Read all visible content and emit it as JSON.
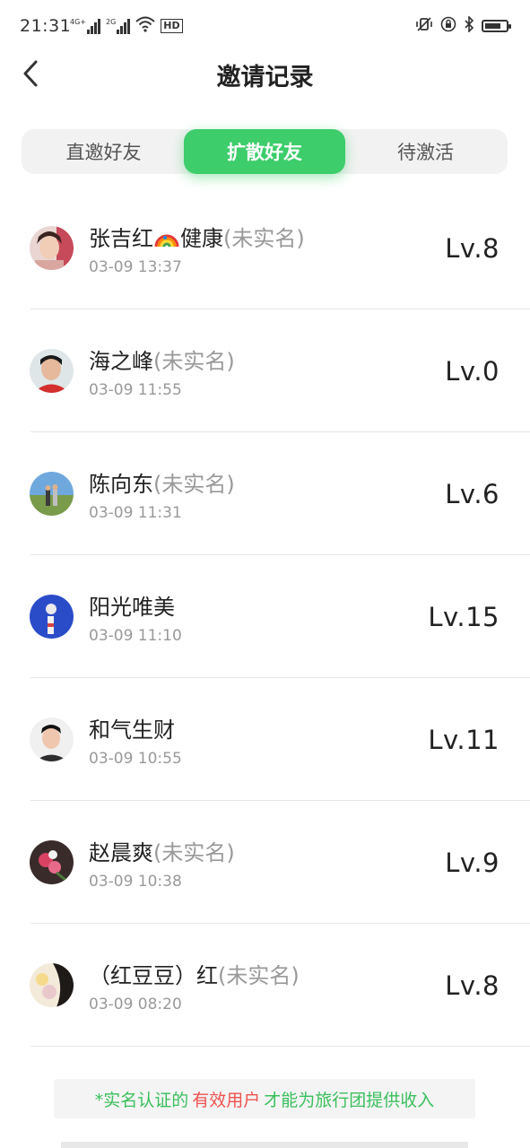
{
  "status_bar": {
    "time": "21:31",
    "signal1_label": "4G+",
    "signal2_label": "2G",
    "hd_label": "HD",
    "battery_level": 0.75
  },
  "nav": {
    "title": "邀请记录",
    "back_icon": "chevron-left-icon"
  },
  "tabs": [
    {
      "label": "直邀好友",
      "active": false
    },
    {
      "label": "扩散好友",
      "active": true
    },
    {
      "label": "待激活",
      "active": false
    }
  ],
  "records": [
    {
      "name": "张吉红",
      "name_suffix": "健康",
      "unverified": "(未实名)",
      "time": "03-09 13:37",
      "level": "Lv.8",
      "has_rainbow": true
    },
    {
      "name": "海之峰",
      "name_suffix": "",
      "unverified": "(未实名)",
      "time": "03-09 11:55",
      "level": "Lv.0",
      "has_rainbow": false
    },
    {
      "name": "陈向东",
      "name_suffix": "",
      "unverified": "(未实名)",
      "time": "03-09 11:31",
      "level": "Lv.6",
      "has_rainbow": false
    },
    {
      "name": "阳光唯美",
      "name_suffix": "",
      "unverified": "",
      "time": "03-09 11:10",
      "level": "Lv.15",
      "has_rainbow": false
    },
    {
      "name": "和气生财",
      "name_suffix": "",
      "unverified": "",
      "time": "03-09 10:55",
      "level": "Lv.11",
      "has_rainbow": false
    },
    {
      "name": "赵晨爽",
      "name_suffix": "",
      "unverified": "(未实名)",
      "time": "03-09 10:38",
      "level": "Lv.9",
      "has_rainbow": false
    },
    {
      "name": "（红豆豆）红",
      "name_suffix": "",
      "unverified": "(未实名)",
      "time": "03-09 08:20",
      "level": "Lv.8",
      "has_rainbow": false
    }
  ],
  "notice": {
    "part1": "*实名认证的",
    "part2": "有效用户",
    "part3": "才能为旅行团提供收入"
  },
  "colors": {
    "accent": "#3dcd6b",
    "notice_green": "#3bbf5c",
    "notice_red": "#ef5350",
    "muted": "#999999"
  }
}
